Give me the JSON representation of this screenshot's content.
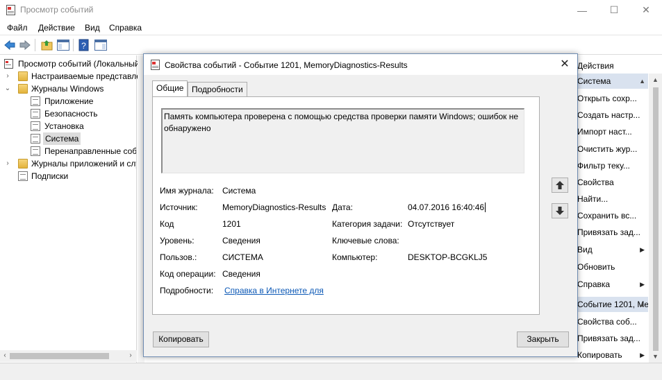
{
  "window": {
    "title": "Просмотр событий",
    "controls": [
      "—",
      "☐",
      "✕"
    ]
  },
  "menu": [
    "Файл",
    "Действие",
    "Вид",
    "Справка"
  ],
  "tree": {
    "root": "Просмотр событий (Локальный)",
    "custom_views": "Настраиваемые представления",
    "windows_logs": "Журналы Windows",
    "logs": [
      "Приложение",
      "Безопасность",
      "Установка",
      "Система",
      "Перенаправленные события"
    ],
    "app_logs": "Журналы приложений и служб",
    "subscriptions": "Подписки"
  },
  "actions": {
    "header": "Действия",
    "section1": "Система",
    "items1": [
      "Открыть сохр...",
      "Создать настр...",
      "Импорт наст...",
      "Очистить жур...",
      "Фильтр теку...",
      "Свойства",
      "Найти...",
      "Сохранить вс...",
      "Привязать зад...",
      "Вид",
      "Обновить",
      "Справка"
    ],
    "section2": "Событие 1201, Me...",
    "items2": [
      "Свойства соб...",
      "Привязать зад...",
      "Копировать"
    ]
  },
  "dialog": {
    "title": "Свойства событий - Событие 1201, MemoryDiagnostics-Results",
    "tabs": [
      "Общие",
      "Подробности"
    ],
    "description": "Память компьютера проверена с помощью средства проверки памяти Windows; ошибок не обнаружено",
    "labels": {
      "log_name": "Имя журнала:",
      "source": "Источник:",
      "event_id": "Код",
      "level": "Уровень:",
      "user": "Пользов.:",
      "opcode": "Код операции:",
      "more_info": "Подробности:",
      "date": "Дата:",
      "task": "Категория задачи:",
      "keywords": "Ключевые слова:",
      "computer": "Компьютер:"
    },
    "values": {
      "log_name": "Система",
      "source": "MemoryDiagnostics-Results",
      "event_id": "1201",
      "level": "Сведения",
      "user": "СИСТЕМА",
      "opcode": "Сведения",
      "more_info_link": "Справка в Интернете для",
      "date": "04.07.2016 16:40:46",
      "task": "Отсутствует",
      "keywords": "",
      "computer": "DESKTOP-BCGKLJ5"
    },
    "buttons": {
      "copy": "Копировать",
      "close": "Закрыть"
    }
  }
}
